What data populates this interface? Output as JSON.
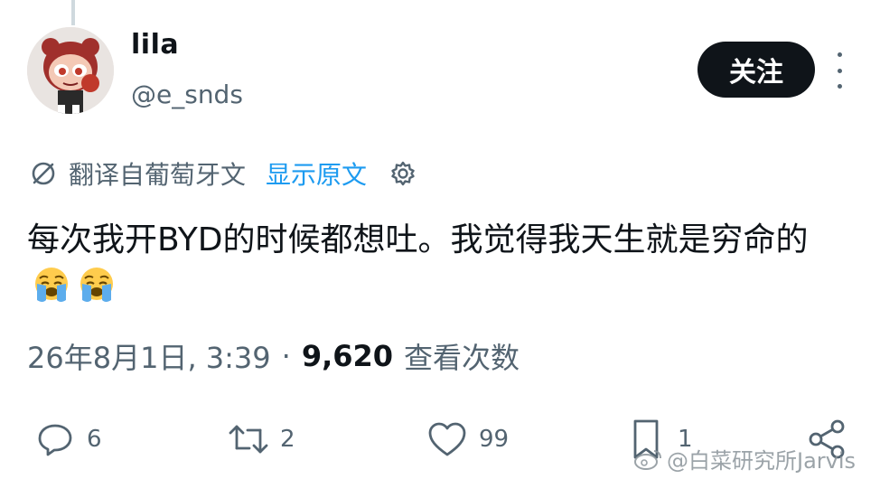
{
  "user": {
    "name": "lila",
    "handle": "@e_snds"
  },
  "follow_label": "关注",
  "translation": {
    "label": "翻译自葡萄牙文",
    "show_original": "显示原文"
  },
  "tweet": {
    "text": "每次我开BYD的时候都想吐。我觉得我天生就是穷命的",
    "emojis": [
      "crying-face-emoji",
      "crying-face-emoji"
    ]
  },
  "meta": {
    "datetime": "26年8月1日, 3:39",
    "separator": "·",
    "views_count": "9,620",
    "views_label": "查看次数"
  },
  "actions": {
    "replies": "6",
    "retweets": "2",
    "likes": "99",
    "bookmarks": "1"
  },
  "watermark": "@白菜研究所Jarvis",
  "colors": {
    "text": "#0f1419",
    "secondary": "#536471",
    "link": "#1d9bf0",
    "button_bg": "#0f1419"
  }
}
